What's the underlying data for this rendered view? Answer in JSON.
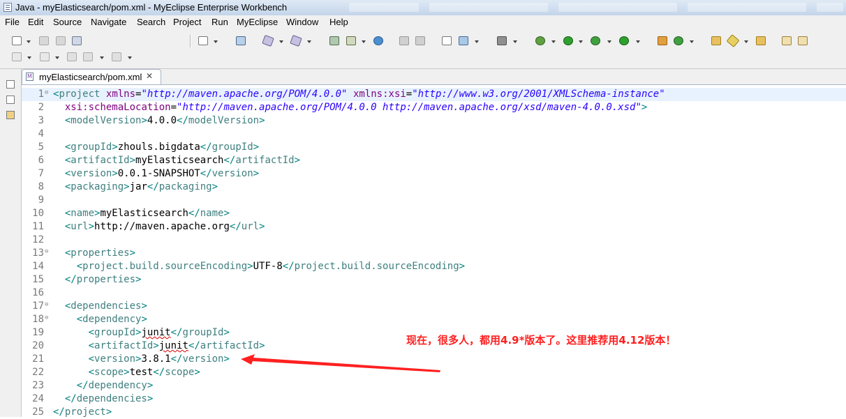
{
  "window": {
    "title": "Java - myElasticsearch/pom.xml - MyEclipse Enterprise Workbench"
  },
  "menu": [
    "File",
    "Edit",
    "Source",
    "Navigate",
    "Search",
    "Project",
    "Run",
    "MyEclipse",
    "Window",
    "Help"
  ],
  "toolbar_icons": [
    "new-icon",
    "save-icon",
    "save-all-icon",
    "print-icon",
    "open-type-icon",
    "web-browser-icon",
    "new-ejb-icon",
    "new-web-project-icon",
    "deploy-icon",
    "server-icon",
    "globe-icon",
    "open-perspective-icon",
    "refactor-icon",
    "wizard-icon",
    "package-icon",
    "browser-icon",
    "debug-icon",
    "run-icon",
    "coverage-icon",
    "external-tools-icon",
    "team-icon",
    "synchronize-icon",
    "folder-icon",
    "pin-icon",
    "annotate-icon",
    "task-icon",
    "bookmark-icon",
    "next-annotation-icon",
    "prev-annotation-icon",
    "back-icon",
    "forward-icon"
  ],
  "editor": {
    "tab_label": "myElasticsearch/pom.xml",
    "lines": [
      "<project xmlns=\"http://maven.apache.org/POM/4.0.0\" xmlns:xsi=\"http://www.w3.org/2001/XMLSchema-instance\"",
      "  xsi:schemaLocation=\"http://maven.apache.org/POM/4.0.0 http://maven.apache.org/xsd/maven-4.0.0.xsd\">",
      "  <modelVersion>4.0.0</modelVersion>",
      "",
      "  <groupId>zhouls.bigdata</groupId>",
      "  <artifactId>myElasticsearch</artifactId>",
      "  <version>0.0.1-SNAPSHOT</version>",
      "  <packaging>jar</packaging>",
      "",
      "  <name>myElasticsearch</name>",
      "  <url>http://maven.apache.org</url>",
      "",
      "  <properties>",
      "    <project.build.sourceEncoding>UTF-8</project.build.sourceEncoding>",
      "  </properties>",
      "",
      "  <dependencies>",
      "    <dependency>",
      "      <groupId>junit</groupId>",
      "      <artifactId>junit</artifactId>",
      "      <version>3.8.1</version>",
      "      <scope>test</scope>",
      "    </dependency>",
      "  </dependencies>",
      "</project>"
    ]
  },
  "annotation": {
    "text": "现在，很多人，都用4.9*版本了。这里推荐用4.12版本！",
    "color": "#ff2020"
  },
  "colors": {
    "tag": "#3f7f7f",
    "attribute": "#7f007f",
    "value": "#2a00ff",
    "line_number": "#787878"
  }
}
